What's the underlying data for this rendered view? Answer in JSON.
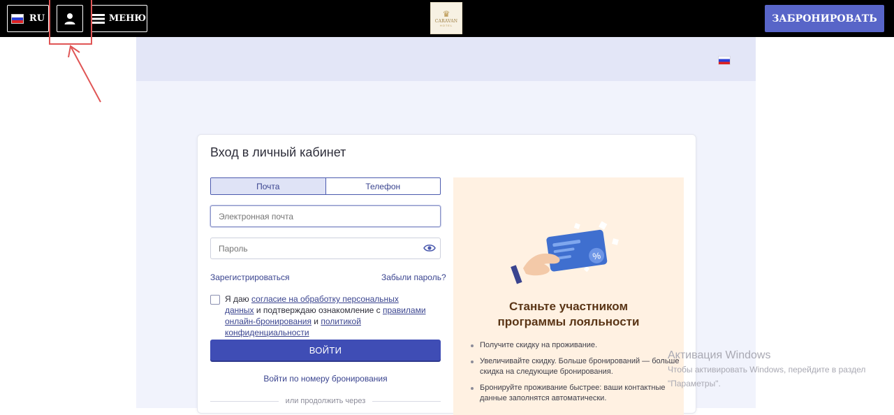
{
  "header": {
    "lang_label": "RU",
    "menu_label": "МЕНЮ",
    "book_label": "ЗАБРОНИРОВАТЬ",
    "logo": {
      "name": "CARAVAN",
      "sub": "HOTEL"
    }
  },
  "login": {
    "title": "Вход в личный кабинет",
    "tabs": [
      "Почта",
      "Телефон"
    ],
    "email_placeholder": "Электронная почта",
    "password_placeholder": "Пароль",
    "register_link": "Зарегистрироваться",
    "forgot_link": "Забыли пароль?",
    "consent": {
      "part1": "Я даю ",
      "link1": "согласие на обработку персональных данных",
      "part2": " и подтверждаю ознакомление с ",
      "link2": "правилами онлайн-бронирования",
      "part3": " и ",
      "link3": "политикой конфиденциальности"
    },
    "submit_label": "ВОЙТИ",
    "booking_link": "Войти по номеру бронирования",
    "or_label": "или продолжить через"
  },
  "loyalty": {
    "title_line1": "Станьте участником",
    "title_line2": "программы лояльности",
    "items": [
      "Получите скидку на проживание.",
      "Увеличивайте скидку. Больше бронирований — больше скидка на следующие бронирования.",
      "Бронируйте проживание быстрее: ваши контактные данные заполнятся автоматически."
    ]
  },
  "windows_watermark": {
    "title": "Активация Windows",
    "line1": "Чтобы активировать Windows, перейдите в раздел",
    "line2": "\"Параметры\"."
  },
  "colors": {
    "topbar": "#000000",
    "accent": "#3f4db5",
    "book_button": "#5865c8",
    "promo_bg": "#fff1e2",
    "page_bg": "#f1f3fc",
    "annotation": "#e05555"
  }
}
